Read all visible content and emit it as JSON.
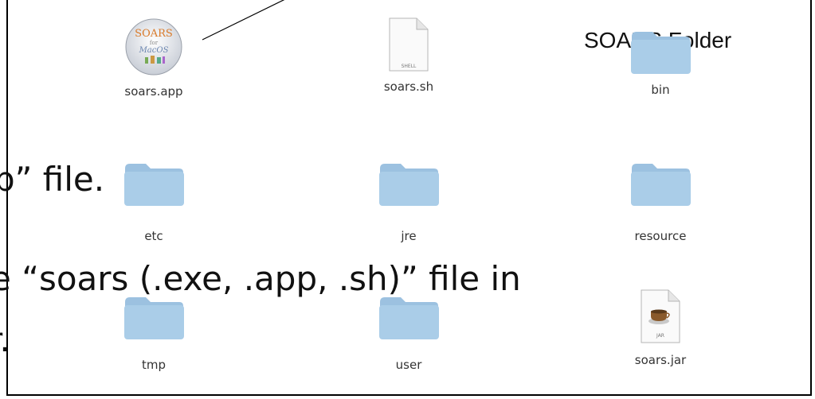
{
  "window": {
    "title_label": "SOARS Folder"
  },
  "files": [
    {
      "name": "soars.app",
      "kind": "app",
      "icon": "soars-app-icon",
      "icon_text_top": "SOARS",
      "icon_text_mid": "for",
      "icon_text_bot": "MacOS"
    },
    {
      "name": "soars.sh",
      "kind": "document",
      "icon": "shell-document-icon",
      "badge": "SHELL"
    },
    {
      "name": "bin",
      "kind": "folder",
      "icon": "folder-icon"
    },
    {
      "name": "etc",
      "kind": "folder",
      "icon": "folder-icon"
    },
    {
      "name": "jre",
      "kind": "folder",
      "icon": "folder-icon"
    },
    {
      "name": "resource",
      "kind": "folder",
      "icon": "folder-icon"
    },
    {
      "name": "tmp",
      "kind": "folder",
      "icon": "folder-icon"
    },
    {
      "name": "user",
      "kind": "folder",
      "icon": "folder-icon"
    },
    {
      "name": "soars.jar",
      "kind": "document",
      "icon": "jar-document-icon",
      "badge": "JAR"
    }
  ],
  "slide_text": {
    "line1": "p” file.",
    "line2": "e “soars (.exe, .app, .sh)” file in",
    "line3": "r."
  },
  "colors": {
    "folder_body": "#a9cbe6",
    "folder_tab": "#9cc1e0",
    "border": "#000000"
  }
}
